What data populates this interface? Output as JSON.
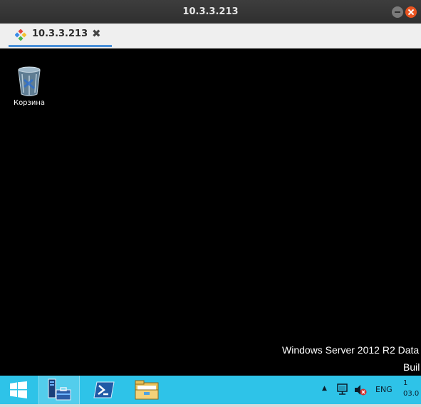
{
  "window": {
    "title": "10.3.3.213"
  },
  "tabs": [
    {
      "label": "10.3.3.213",
      "icon": "remote-desktop-icon",
      "close_glyph": "✖"
    }
  ],
  "desktop": {
    "icons": [
      {
        "label": "Корзина",
        "icon": "recycle-bin-icon"
      }
    ],
    "watermark": {
      "line1": "Windows Server 2012 R2 Data",
      "line2": "Buil"
    }
  },
  "taskbar": {
    "color": "#2ec3e8",
    "buttons": [
      {
        "name": "start",
        "icon": "windows-logo-icon"
      },
      {
        "name": "server-manager",
        "icon": "server-manager-icon"
      },
      {
        "name": "powershell",
        "icon": "powershell-icon"
      },
      {
        "name": "file-explorer",
        "icon": "folder-icon"
      }
    ],
    "tray": {
      "arrow": "▲",
      "language": "ENG",
      "time": "1",
      "date": "03.0"
    }
  }
}
